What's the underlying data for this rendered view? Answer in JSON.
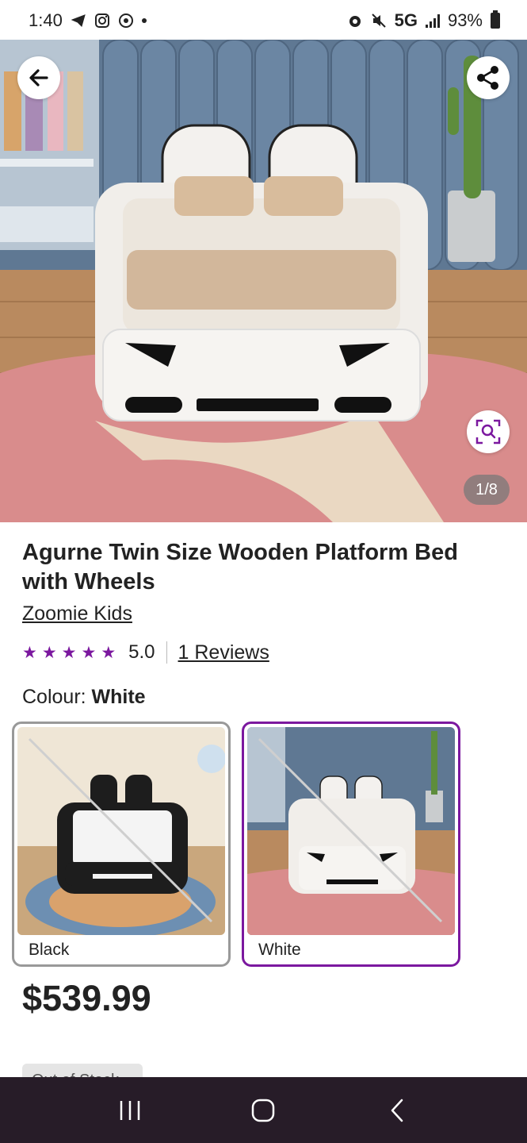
{
  "status_bar": {
    "time": "1:40",
    "network": "5G",
    "battery": "93%",
    "icons": [
      "telegram-icon",
      "instagram-icon",
      "chrome-icon",
      "notification-dot-icon",
      "alarm-icon",
      "mute-icon",
      "signal-icon",
      "battery-icon"
    ]
  },
  "hero": {
    "image_counter": "1/8",
    "icons": [
      "back-arrow-icon",
      "share-icon",
      "visual-search-icon"
    ]
  },
  "product": {
    "title": "Agurne Twin Size Wooden Platform Bed with Wheels",
    "brand": "Zoomie Kids",
    "rating": 5.0,
    "rating_text": "5.0",
    "stars": [
      "★",
      "★",
      "★",
      "★",
      "★"
    ],
    "reviews_link": "1 Reviews",
    "price": "$539.99",
    "stock_badge": "Out of Stock"
  },
  "colour": {
    "label": "Colour:",
    "selected": "White",
    "options": [
      {
        "name": "Black",
        "selected": false
      },
      {
        "name": "White",
        "selected": true
      }
    ]
  },
  "colors": {
    "accent": "#7b189f",
    "nav_bar": "#271c28",
    "text": "#222222"
  },
  "nav_bar": {
    "icons": [
      "recent-apps-icon",
      "home-icon",
      "back-icon"
    ]
  }
}
